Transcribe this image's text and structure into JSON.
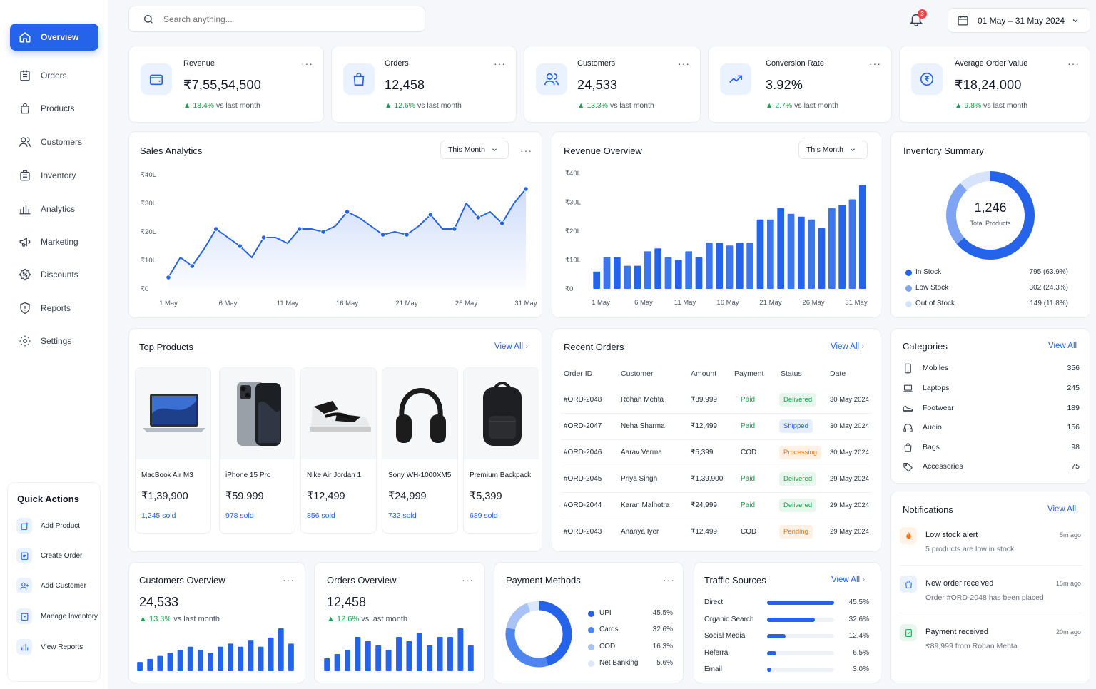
{
  "sidebar": {
    "items": [
      {
        "label": "Overview",
        "icon": "home-icon",
        "active": true
      },
      {
        "label": "Orders",
        "icon": "orders-icon"
      },
      {
        "label": "Products",
        "icon": "bag-icon"
      },
      {
        "label": "Customers",
        "icon": "users-icon"
      },
      {
        "label": "Inventory",
        "icon": "box-icon"
      },
      {
        "label": "Analytics",
        "icon": "bar-chart-icon"
      },
      {
        "label": "Marketing",
        "icon": "megaphone-icon"
      },
      {
        "label": "Discounts",
        "icon": "discount-icon"
      },
      {
        "label": "Reports",
        "icon": "shield-icon"
      },
      {
        "label": "Settings",
        "icon": "gear-icon"
      }
    ],
    "quick_actions": {
      "title": "Quick Actions",
      "items": [
        {
          "label": "Add Product",
          "icon": "add-product-icon"
        },
        {
          "label": "Create Order",
          "icon": "create-order-icon"
        },
        {
          "label": "Add Customer",
          "icon": "add-customer-icon"
        },
        {
          "label": "Manage Inventory",
          "icon": "inventory-icon"
        },
        {
          "label": "View Reports",
          "icon": "reports-icon"
        }
      ]
    }
  },
  "header": {
    "search_placeholder": "Search anything...",
    "notification_count": "3",
    "date_range": "01 May – 31 May 2024"
  },
  "kpis": [
    {
      "label": "Revenue",
      "value": "₹7,55,54,500",
      "change": "18.4%",
      "suffix": "vs last month",
      "icon": "wallet-icon"
    },
    {
      "label": "Orders",
      "value": "12,458",
      "change": "12.6%",
      "suffix": "vs last month",
      "icon": "shopping-bag-icon"
    },
    {
      "label": "Customers",
      "value": "24,533",
      "change": "13.3%",
      "suffix": "vs last month",
      "icon": "users-icon"
    },
    {
      "label": "Conversion Rate",
      "value": "3.92%",
      "change": "2.7%",
      "suffix": "vs last month",
      "icon": "trend-up-icon"
    },
    {
      "label": "Average Order Value",
      "value": "₹18,24,000",
      "change": "9.8%",
      "suffix": "vs last month",
      "icon": "rupee-icon"
    }
  ],
  "sales_analytics": {
    "title": "Sales Analytics",
    "filter": "This Month"
  },
  "revenue_overview": {
    "title": "Revenue Overview",
    "filter": "This Month"
  },
  "inventory": {
    "title": "Inventory Summary",
    "total": "1,246",
    "total_label": "Total Products",
    "items": [
      {
        "label": "In Stock",
        "value": "795 (63.9%)",
        "color": "#2563eb"
      },
      {
        "label": "Low Stock",
        "value": "302 (24.3%)",
        "color": "#7ea4f3"
      },
      {
        "label": "Out of Stock",
        "value": "149 (11.8%)",
        "color": "#d7e3fb"
      }
    ]
  },
  "top_products": {
    "title": "Top Products",
    "view_all": "View All",
    "items": [
      {
        "name": "MacBook Air M3",
        "price": "₹1,39,900",
        "sold": "1,245 sold"
      },
      {
        "name": "iPhone 15 Pro",
        "price": "₹59,999",
        "sold": "978 sold"
      },
      {
        "name": "Nike Air Jordan 1",
        "price": "₹12,499",
        "sold": "856 sold"
      },
      {
        "name": "Sony WH-1000XM5",
        "price": "₹24,999",
        "sold": "732 sold"
      },
      {
        "name": "Premium Backpack",
        "price": "₹5,399",
        "sold": "689 sold"
      }
    ]
  },
  "recent_orders": {
    "title": "Recent Orders",
    "view_all": "View All",
    "columns": [
      "Order ID",
      "Customer",
      "Amount",
      "Payment",
      "Status",
      "Date"
    ],
    "rows": [
      {
        "id": "#ORD-2048",
        "customer": "Rohan Mehta",
        "amount": "₹89,999",
        "payment": "Paid",
        "status": "Delivered",
        "date": "30 May 2024"
      },
      {
        "id": "#ORD-2047",
        "customer": "Neha Sharma",
        "amount": "₹12,499",
        "payment": "Paid",
        "status": "Shipped",
        "date": "30 May 2024"
      },
      {
        "id": "#ORD-2046",
        "customer": "Aarav Verma",
        "amount": "₹5,399",
        "payment": "COD",
        "status": "Processing",
        "date": "30 May 2024"
      },
      {
        "id": "#ORD-2045",
        "customer": "Priya Singh",
        "amount": "₹1,39,900",
        "payment": "Paid",
        "status": "Delivered",
        "date": "29 May 2024"
      },
      {
        "id": "#ORD-2044",
        "customer": "Karan Malhotra",
        "amount": "₹24,999",
        "payment": "Paid",
        "status": "Delivered",
        "date": "29 May 2024"
      },
      {
        "id": "#ORD-2043",
        "customer": "Ananya Iyer",
        "amount": "₹12,499",
        "payment": "COD",
        "status": "Pending",
        "date": "29 May 2024"
      }
    ]
  },
  "categories": {
    "title": "Categories",
    "view_all": "View All",
    "items": [
      {
        "label": "Mobiles",
        "count": "356",
        "icon": "mobile-icon"
      },
      {
        "label": "Laptops",
        "count": "245",
        "icon": "laptop-icon"
      },
      {
        "label": "Footwear",
        "count": "189",
        "icon": "shoe-icon"
      },
      {
        "label": "Audio",
        "count": "156",
        "icon": "headphones-icon"
      },
      {
        "label": "Bags",
        "count": "98",
        "icon": "bag-icon"
      },
      {
        "label": "Accessories",
        "count": "75",
        "icon": "tag-icon"
      }
    ]
  },
  "notifications": {
    "title": "Notifications",
    "view_all": "View All",
    "items": [
      {
        "title": "Low stock alert",
        "sub": "5 products are low in stock",
        "time": "5m ago",
        "icon": "alert-icon"
      },
      {
        "title": "New order received",
        "sub": "Order #ORD-2048 has been placed",
        "time": "15m ago",
        "icon": "order-icon"
      },
      {
        "title": "Payment received",
        "sub": "₹89,999 from Rohan Mehta",
        "time": "20m ago",
        "icon": "payment-icon"
      }
    ]
  },
  "customers_overview": {
    "title": "Customers Overview",
    "value": "24,533",
    "change": "13.3%",
    "suffix": "vs last month"
  },
  "orders_overview": {
    "title": "Orders Overview",
    "value": "12,458",
    "change": "12.6%",
    "suffix": "vs last month"
  },
  "payment_methods": {
    "title": "Payment Methods",
    "items": [
      {
        "label": "UPI",
        "value": "45.5%",
        "color": "#2563eb"
      },
      {
        "label": "Cards",
        "value": "32.6%",
        "color": "#4f85ee"
      },
      {
        "label": "COD",
        "value": "16.3%",
        "color": "#a9c3f7"
      },
      {
        "label": "Net Banking",
        "value": "5.6%",
        "color": "#dde7fb"
      }
    ]
  },
  "traffic_sources": {
    "title": "Traffic Sources",
    "view_all": "View All",
    "items": [
      {
        "label": "Direct",
        "value": "45.5%",
        "fraction": 0.455
      },
      {
        "label": "Organic Search",
        "value": "32.6%",
        "fraction": 0.326
      },
      {
        "label": "Social Media",
        "value": "12.4%",
        "fraction": 0.124
      },
      {
        "label": "Referral",
        "value": "6.5%",
        "fraction": 0.065
      },
      {
        "label": "Email",
        "value": "3.0%",
        "fraction": 0.03
      }
    ]
  },
  "chart_data": [
    {
      "type": "area",
      "title": "Sales Analytics",
      "xlabel": "",
      "ylabel": "",
      "x_ticks": [
        "1 May",
        "6 May",
        "11 May",
        "16 May",
        "21 May",
        "26 May",
        "31 May"
      ],
      "y_ticks": [
        "₹0",
        "₹10L",
        "₹20L",
        "₹30L",
        "₹40L"
      ],
      "ylim": [
        0,
        40
      ],
      "x": [
        1,
        2,
        3,
        4,
        5,
        6,
        7,
        8,
        9,
        10,
        11,
        12,
        13,
        14,
        15,
        16,
        17,
        18,
        19,
        20,
        21,
        22,
        23,
        24,
        25,
        26,
        27,
        28,
        29,
        30,
        31
      ],
      "values": [
        4,
        11,
        8,
        14,
        21,
        18,
        15,
        11,
        18,
        18,
        16,
        21,
        21,
        20,
        22,
        27,
        25,
        22,
        19,
        20,
        19,
        22,
        26,
        21,
        21,
        30,
        25,
        27,
        23,
        30,
        35
      ],
      "marker_days": [
        1,
        3,
        5,
        7,
        9,
        12,
        14,
        16,
        19,
        21,
        23,
        25,
        27,
        29,
        31
      ]
    },
    {
      "type": "bar",
      "title": "Revenue Overview",
      "xlabel": "",
      "ylabel": "",
      "x_ticks": [
        "1 May",
        "6 May",
        "11 May",
        "16 May",
        "21 May",
        "26 May",
        "31 May"
      ],
      "y_ticks": [
        "₹0",
        "₹10L",
        "₹20L",
        "₹30L",
        "₹40L"
      ],
      "ylim": [
        0,
        40
      ],
      "values": [
        6,
        11,
        11,
        8,
        8,
        13,
        14,
        11,
        10,
        13,
        11,
        16,
        16,
        15,
        16,
        16,
        24,
        24,
        28,
        26,
        25,
        24,
        21,
        28,
        29,
        31,
        36
      ]
    },
    {
      "type": "bar",
      "title": "Customers Overview",
      "values": [
        3,
        4,
        5,
        6,
        7,
        8,
        7,
        6,
        8,
        9,
        8,
        10,
        8,
        11,
        14,
        9
      ]
    },
    {
      "type": "bar",
      "title": "Orders Overview",
      "values": [
        3,
        4,
        5,
        8,
        7,
        6,
        5,
        8,
        7,
        9,
        6,
        8,
        8,
        10,
        6
      ]
    },
    {
      "type": "pie",
      "title": "Payment Methods",
      "categories": [
        "UPI",
        "Cards",
        "COD",
        "Net Banking"
      ],
      "values": [
        45.5,
        32.6,
        16.3,
        5.6
      ]
    },
    {
      "type": "pie",
      "title": "Inventory Summary",
      "categories": [
        "In Stock",
        "Low Stock",
        "Out of Stock"
      ],
      "values": [
        795,
        302,
        149
      ]
    }
  ],
  "colors": {
    "accent": "#2563eb",
    "up": "#16a34a",
    "paid": "#16a34a"
  }
}
